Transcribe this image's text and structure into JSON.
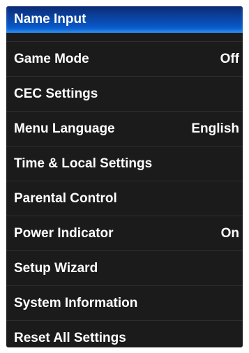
{
  "menu": {
    "items": [
      {
        "label": "Name Input",
        "value": ""
      },
      {
        "label": "Game Mode",
        "value": "Off"
      },
      {
        "label": "CEC Settings",
        "value": ""
      },
      {
        "label": "Menu Language",
        "value": "English"
      },
      {
        "label": "Time & Local Settings",
        "value": ""
      },
      {
        "label": "Parental Control",
        "value": ""
      },
      {
        "label": "Power Indicator",
        "value": "On"
      },
      {
        "label": "Setup Wizard",
        "value": ""
      },
      {
        "label": "System Information",
        "value": ""
      },
      {
        "label": "Reset All Settings",
        "value": ""
      }
    ],
    "selected_index": 0,
    "colors": {
      "background": "#1b1b1b",
      "highlight": "#0a56c4",
      "text": "#ffffff"
    }
  }
}
